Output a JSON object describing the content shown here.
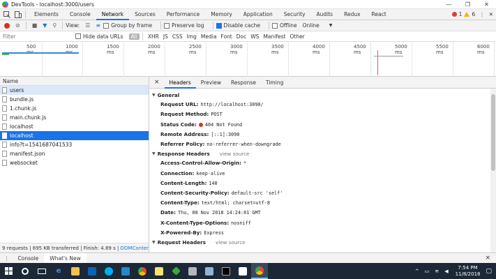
{
  "window": {
    "title": "DevTools - localhost:3000/users",
    "controls": [
      "—",
      "❐",
      "✕"
    ]
  },
  "main_tabs": [
    "Elements",
    "Console",
    "Network",
    "Sources",
    "Performance",
    "Memory",
    "Application",
    "Security",
    "Audits",
    "Redux",
    "React"
  ],
  "active_main_tab": "Network",
  "counters": {
    "errors": "1",
    "warnings": "6"
  },
  "toolbar": {
    "view_label": "View:",
    "group_by_frame": "Group by frame",
    "preserve_log": "Preserve log",
    "disable_cache": "Disable cache",
    "offline": "Offline",
    "throttle_value": "Online"
  },
  "filter": {
    "placeholder": "Filter",
    "hide_data_urls": "Hide data URLs",
    "types": [
      "All",
      "XHR",
      "JS",
      "CSS",
      "Img",
      "Media",
      "Font",
      "Doc",
      "WS",
      "Manifest",
      "Other"
    ]
  },
  "timeline": {
    "ticks": [
      "500 ms",
      "1000 ms",
      "1500 ms",
      "2000 ms",
      "2500 ms",
      "3000 ms",
      "3500 ms",
      "4000 ms",
      "4500 ms",
      "5000 ms",
      "5500 ms",
      "6000 ms"
    ]
  },
  "requests": {
    "header": "Name",
    "items": [
      "users",
      "bundle.js",
      "1.chunk.js",
      "main.chunk.js",
      "localhost",
      "localhost",
      "info?t=1541687041533",
      "manifest.json",
      "websocket"
    ],
    "selected_index": 5,
    "highlight_index": 0
  },
  "status": {
    "text": "9 requests | 695 KB transferred | Finish: 4.89 s | ",
    "link": "DOMContent…"
  },
  "detail": {
    "close": "×",
    "tabs": [
      "Headers",
      "Preview",
      "Response",
      "Timing"
    ],
    "active_tab": "Headers",
    "general": {
      "title": "General",
      "rows": [
        {
          "k": "Request URL:",
          "v": "http://localhost:3090/"
        },
        {
          "k": "Request Method:",
          "v": "POST"
        },
        {
          "k": "Status Code:",
          "v": "404 Not Found"
        },
        {
          "k": "Remote Address:",
          "v": "[::1]:3090"
        },
        {
          "k": "Referrer Policy:",
          "v": "no-referrer-when-downgrade"
        }
      ]
    },
    "response_headers": {
      "title": "Response Headers",
      "view_source": "view source",
      "rows": [
        {
          "k": "Access-Control-Allow-Origin:",
          "v": "*"
        },
        {
          "k": "Connection:",
          "v": "keep-alive"
        },
        {
          "k": "Content-Length:",
          "v": "140"
        },
        {
          "k": "Content-Security-Policy:",
          "v": "default-src 'self'"
        },
        {
          "k": "Content-Type:",
          "v": "text/html; charset=utf-8"
        },
        {
          "k": "Date:",
          "v": "Thu, 08 Nov 2018 14:24:01 GMT"
        },
        {
          "k": "X-Content-Type-Options:",
          "v": "nosniff"
        },
        {
          "k": "X-Powered-By:",
          "v": "Express"
        }
      ]
    },
    "request_headers": {
      "title": "Request Headers",
      "view_source": "view source"
    }
  },
  "drawer": {
    "tabs": [
      "Console",
      "What's New"
    ],
    "active": "What's New",
    "close": "×"
  },
  "taskbar": {
    "time": "7:54 PM",
    "date": "11/8/2018",
    "apps": [
      "windows",
      "cortana",
      "task-view",
      "edge",
      "explorer",
      "outlook",
      "skype",
      "vscode",
      "chrome",
      "sticky",
      "store",
      "git",
      "cmd",
      "green",
      "chrome-active"
    ]
  },
  "colors": {
    "accent": "#1a73e8",
    "selected_row": "#1a73e8",
    "error": "#d93025",
    "taskbar": "#1d2836"
  }
}
